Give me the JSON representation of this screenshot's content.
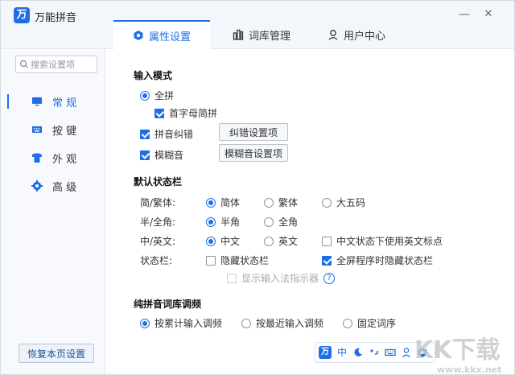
{
  "window": {
    "title": "万能拼音"
  },
  "controls": {
    "minimize": "—",
    "close": "✕"
  },
  "tabs": [
    {
      "label": "属性设置",
      "icon": "hexagon-icon",
      "active": true
    },
    {
      "label": "词库管理",
      "icon": "bars-icon",
      "active": false
    },
    {
      "label": "用户中心",
      "icon": "person-icon",
      "active": false
    }
  ],
  "sidebar": {
    "search_placeholder": "搜索设置项",
    "items": [
      {
        "label": "常 规",
        "icon": "monitor-icon",
        "active": true
      },
      {
        "label": "按 键",
        "icon": "keyboard-icon",
        "active": false
      },
      {
        "label": "外 观",
        "icon": "shirt-icon",
        "active": false
      },
      {
        "label": "高 级",
        "icon": "gear-icon",
        "active": false
      }
    ],
    "restore_label": "恢复本页设置"
  },
  "input_mode": {
    "title": "输入模式",
    "quanpin": "全拼",
    "shouzimu": "首字母简拼",
    "jiucuo": "拼音纠错",
    "jiucuo_btn": "纠错设置项",
    "mohu": "模糊音",
    "mohu_btn": "模糊音设置项"
  },
  "status_bar": {
    "title": "默认状态栏",
    "jianfan_label": "简/繁体:",
    "jianti": "简体",
    "fanti": "繁体",
    "dawuma": "大五码",
    "banquan_label": "半/全角:",
    "banjiao": "半角",
    "quanjiao": "全角",
    "zhongying_label": "中/英文:",
    "zhongwen": "中文",
    "yingwen": "英文",
    "eng_punct": "中文状态下使用英文标点",
    "zhuangtai_label": "状态栏:",
    "hide_bar": "隐藏状态栏",
    "fullscreen_hide": "全屏程序时隐藏状态栏",
    "show_indicator": "显示输入法指示器",
    "help": "?"
  },
  "freq": {
    "title": "纯拼音词库调频",
    "leiji": "按累计输入调频",
    "zuijin": "按最近输入调频",
    "guding": "固定词序"
  },
  "ime_bar": {
    "zh": "中",
    "logo": "万"
  },
  "colors": {
    "accent": "#1d6fe8"
  }
}
